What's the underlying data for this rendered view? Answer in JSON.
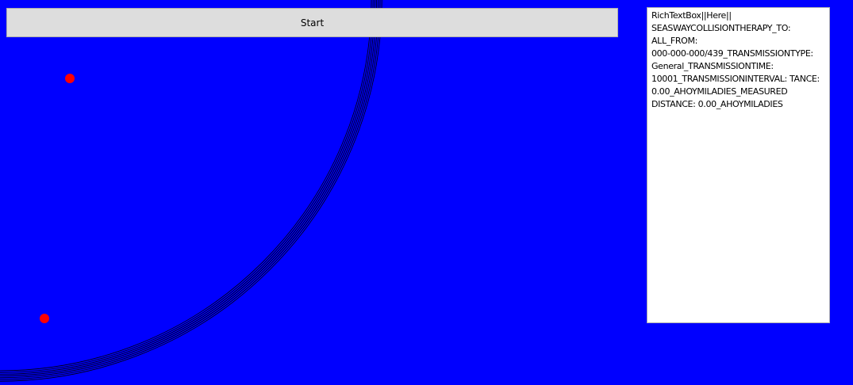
{
  "window": {
    "background_color": "#0000FF"
  },
  "start_button": {
    "label": "Start"
  },
  "rich_text_box": {
    "text": "RichTextBox||Here||\nSEASWAYCOLLISIONTHERAPY_TO:\nALL_FROM:\n000-000-000/439_TRANSMISSIONTYPE:\nGeneral_TRANSMISSIONTIME:\n10001_TRANSMISSIONINTERVAL: TANCE:\n0.00_AHOYMILADIES_MEASURED\nDISTANCE: 0.00_AHOYMILADIES"
  },
  "radar": {
    "ring_color": "#000000",
    "ring_count": 7,
    "marker_color": "#FF0000",
    "marker_count": 2
  }
}
